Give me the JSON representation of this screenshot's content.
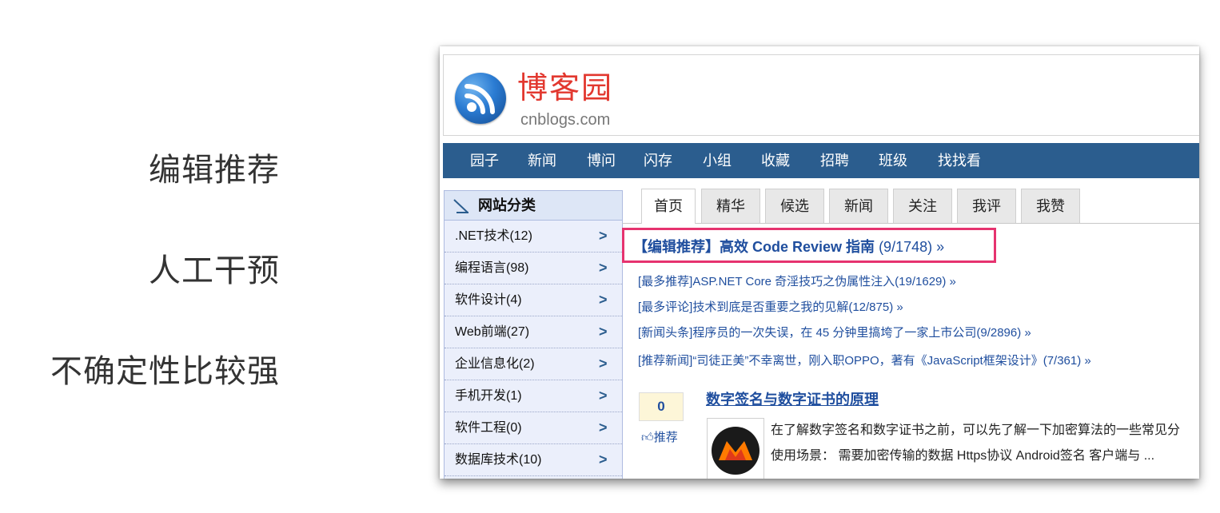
{
  "notes": [
    "编辑推荐",
    "人工干预",
    "不确定性比较强"
  ],
  "header": {
    "logo_cn": "博客园",
    "logo_en": "cnblogs.com"
  },
  "nav": [
    "园子",
    "新闻",
    "博问",
    "闪存",
    "小组",
    "收藏",
    "招聘",
    "班级",
    "找找看"
  ],
  "sidebar": {
    "title": "网站分类",
    "items": [
      {
        "label": ".NET技术(12)"
      },
      {
        "label": "编程语言(98)"
      },
      {
        "label": "软件设计(4)"
      },
      {
        "label": "Web前端(27)"
      },
      {
        "label": "企业信息化(2)"
      },
      {
        "label": "手机开发(1)"
      },
      {
        "label": "软件工程(0)"
      },
      {
        "label": "数据库技术(10)"
      }
    ],
    "arrow": ">"
  },
  "tabs": [
    "首页",
    "精华",
    "候选",
    "新闻",
    "关注",
    "我评",
    "我赞"
  ],
  "featured": {
    "title": "【编辑推荐】高效 Code Review 指南",
    "count": "(9/1748) »"
  },
  "headlines": [
    "[最多推荐]ASP.NET Core 奇淫技巧之伪属性注入(19/1629) »",
    "[最多评论]技术到底是否重要之我的见解(12/875) »",
    "[新闻头条]程序员的一次失误，在 45 分钟里搞垮了一家上市公司(9/2896) »",
    "[推荐新闻]“司徒正美”不幸离世，刚入职OPPO，著有《JavaScript框架设计》(7/361) »"
  ],
  "post": {
    "digg_count": "0",
    "digg_label": "推荐",
    "title": "数字签名与数字证书的原理",
    "summary_line1": "在了解数字签名和数字证书之前，可以先了解一下加密算法的一些常见分",
    "summary_line2": "使用场景： 需要加密传输的数据 Https协议 Android签名 客户端与 ..."
  },
  "colors": {
    "nav_bg": "#2b5d8e",
    "logo_red": "#e2382f",
    "link_blue": "#1f4e9e",
    "highlight": "#e6336f"
  }
}
